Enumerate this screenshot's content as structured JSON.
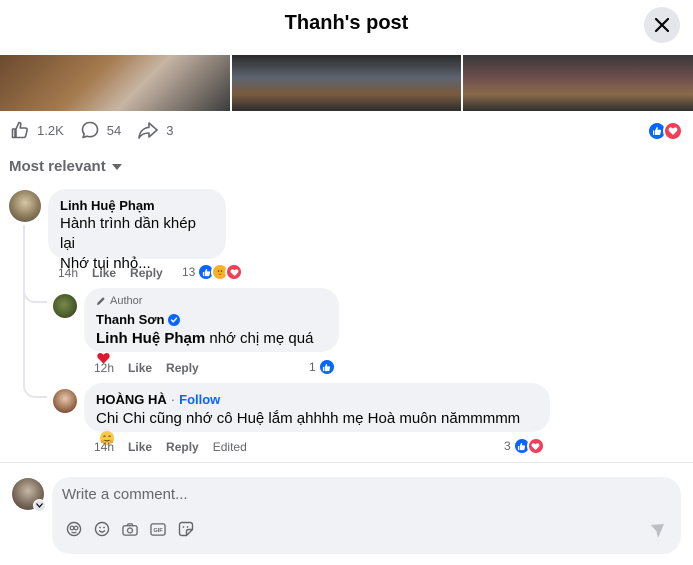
{
  "header": {
    "title": "Thanh's post"
  },
  "post_stats": {
    "likes": "1.2K",
    "comments": "54",
    "shares": "3"
  },
  "sort": {
    "label": "Most relevant"
  },
  "comments": [
    {
      "name": "Linh Huệ Phạm",
      "lines": [
        "Hành trình dần khép lại",
        "Nhớ tụi nhỏ..."
      ],
      "time": "14h",
      "like": "Like",
      "reply": "Reply",
      "reaction_count": "13"
    },
    {
      "author_tag": "Author",
      "name": "Thanh Sơn",
      "mention": "Linh Huệ Phạm",
      "text": " nhớ chị mẹ quá",
      "time": "12h",
      "like": "Like",
      "reply": "Reply",
      "reaction_count": "1"
    },
    {
      "name": "HOÀNG HÀ",
      "follow": "Follow",
      "text": "Chi Chi cũng nhớ cô Huệ lắm ạhhhh mẹ Hoà muôn nămmmmm",
      "time": "14h",
      "like": "Like",
      "reply": "Reply",
      "edited": "Edited",
      "reaction_count": "3"
    }
  ],
  "composer": {
    "placeholder": "Write a comment..."
  },
  "colors": {
    "like_blue": "#0866ff",
    "love_red": "#f33e58",
    "haha_yellow": "#f7b125",
    "muted": "#65676b",
    "bubble": "#f0f2f5"
  },
  "icons": [
    "close-icon",
    "like-icon",
    "comment-icon",
    "share-icon",
    "chevron-down-icon",
    "verified-icon",
    "pencil-icon",
    "send-icon",
    "avatar-icon",
    "emoji-icon",
    "camera-icon",
    "gif-icon",
    "sticker-icon"
  ]
}
